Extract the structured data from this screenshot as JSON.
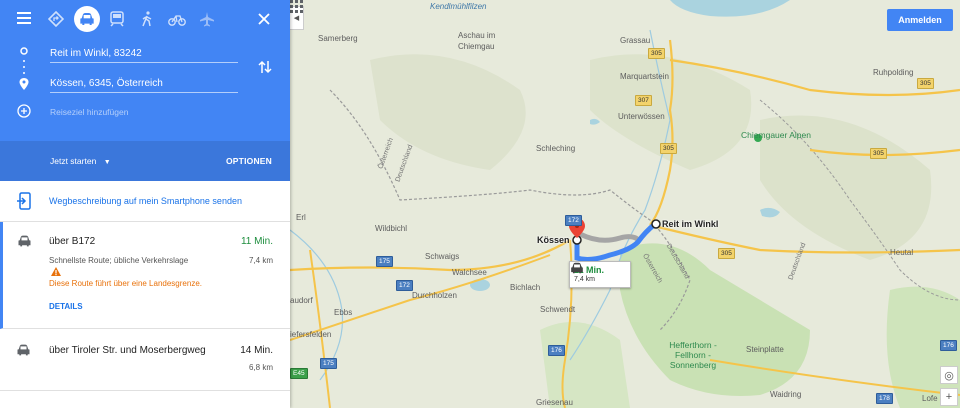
{
  "panel": {
    "modes": [
      {
        "name": "best-route-icon",
        "selected": false
      },
      {
        "name": "car-icon",
        "selected": true
      },
      {
        "name": "train-icon",
        "selected": false
      },
      {
        "name": "walk-icon",
        "selected": false
      },
      {
        "name": "bike-icon",
        "selected": false
      },
      {
        "name": "flight-icon",
        "selected": false
      }
    ],
    "origin": "Reit im Winkl, 83242",
    "destination": "Kössen, 6345, Österreich",
    "add_destination": "Reiseziel hinzufügen",
    "start_label": "Jetzt starten",
    "options_label": "OPTIONEN",
    "send_label": "Wegbeschreibung auf mein Smartphone senden",
    "routes": [
      {
        "via": "über B172",
        "time": "11 Min.",
        "distance": "7,4 km",
        "description": "Schnellste Route; übliche Verkehrslage",
        "warning": "Diese Route führt über eine Landesgrenze.",
        "details_label": "DETAILS"
      },
      {
        "via": "über Tiroler Str. und Moserbergweg",
        "time": "14 Min.",
        "distance": "6,8 km"
      }
    ]
  },
  "header": {
    "signin_label": "Anmelden"
  },
  "map": {
    "route_card": {
      "time": "11 Min.",
      "distance": "7,4 km"
    },
    "endpoints": {
      "start": "Reit im Winkl",
      "end": "Kössen"
    },
    "places": [
      "Kendlmühlfilzen",
      "Samerberg",
      "Aschau im Chiemgau",
      "Grassau",
      "Marquartstein",
      "Ruhpolding",
      "Unterwössen",
      "Chiemgauer Alpen",
      "Schleching",
      "Erl",
      "Wildbichl",
      "Schwaigs",
      "Walchsee",
      "Durchholzen",
      "Bichlach",
      "Ebbs",
      "Schwendt",
      "Hefferthorn - Fellhorn - Sonnenberg",
      "Steinplatte",
      "Heutal",
      "Griesenau",
      "Waidring",
      "audorf",
      "iefersfelden",
      "Lofe"
    ],
    "border_labels": [
      "Österreich",
      "Deutschland"
    ],
    "road_labels": [
      "305",
      "307",
      "305",
      "305",
      "305",
      "175",
      "172",
      "176",
      "175",
      "176",
      "178",
      "172",
      "178",
      "E45"
    ],
    "colors": {
      "route": "#4285f4",
      "alt_route": "#a5a5a5",
      "panel_header": "#4285f4",
      "park": "#c9e1b4",
      "water": "#aad3df"
    }
  }
}
